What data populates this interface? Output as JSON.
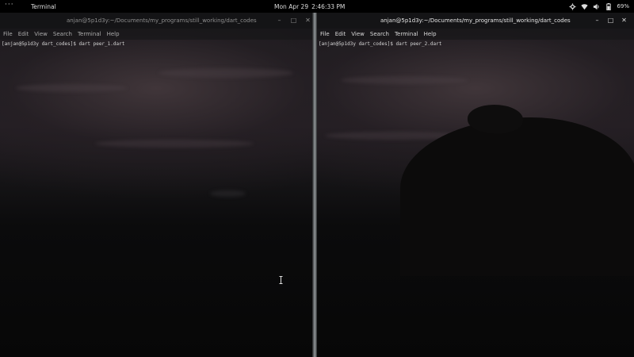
{
  "top_panel": {
    "activities": "···",
    "app_menu": "Terminal",
    "clock_date": "Mon Apr 29",
    "clock_time": "2:46:33 PM",
    "battery_percent": "69%",
    "icons": [
      "settings-icon",
      "wifi-icon",
      "volume-icon",
      "battery-icon"
    ]
  },
  "terminal_left": {
    "title": "anjan@5p1d3y:~/Documents/my_programs/still_working/dart_codes",
    "menu": [
      "File",
      "Edit",
      "View",
      "Search",
      "Terminal",
      "Help"
    ],
    "prompt": "[anjan@5p1d3y dart_codes]$ dart peer_1.dart",
    "buttons": [
      "minimize",
      "maximize",
      "close"
    ]
  },
  "terminal_right": {
    "title": "anjan@5p1d3y:~/Documents/my_programs/still_working/dart_codes",
    "menu": [
      "File",
      "Edit",
      "View",
      "Search",
      "Terminal",
      "Help"
    ],
    "prompt": "[anjan@5p1d3y dart_codes]$ dart peer_2.dart",
    "buttons": [
      "minimize",
      "maximize",
      "close"
    ]
  }
}
